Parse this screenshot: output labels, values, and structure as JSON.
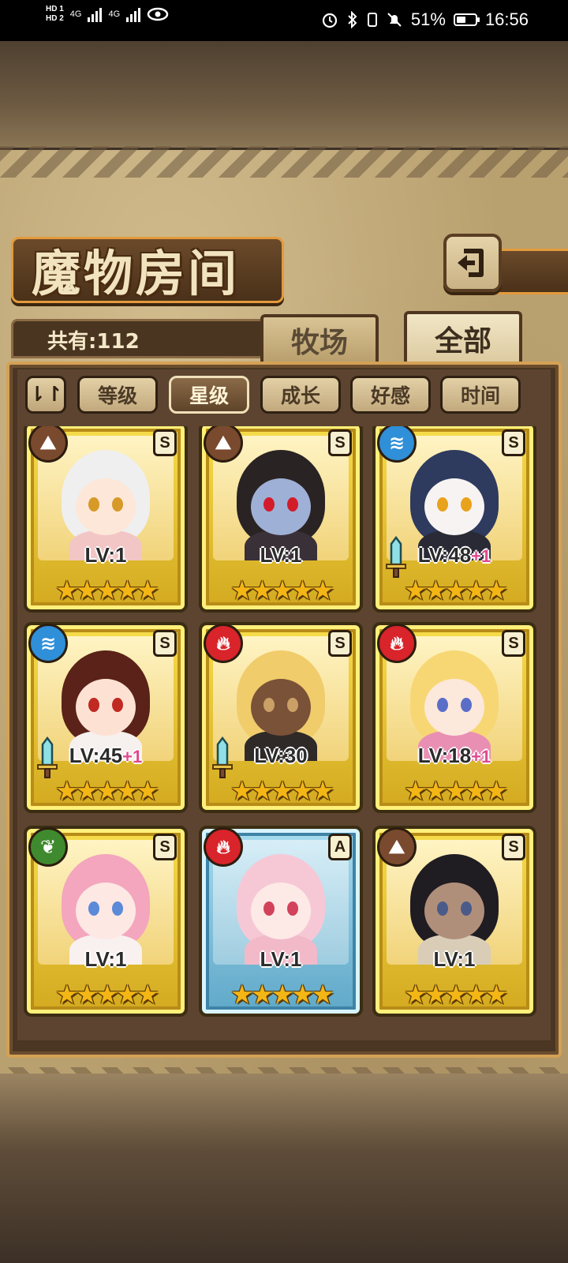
{
  "status_bar": {
    "hd1": "HD 1",
    "hd2": "HD 2",
    "net1": "4G",
    "net2": "4G",
    "battery_percent": "51%",
    "battery_level": 0.51,
    "time": "16:56"
  },
  "header": {
    "title": "魔物房间",
    "back_icon": "return-arrow-icon"
  },
  "summary": {
    "count_label": "共有:112"
  },
  "top_tabs": [
    {
      "label": "牧场",
      "active": false
    },
    {
      "label": "全部",
      "active": true
    }
  ],
  "sort_bar": {
    "toggle_label": "⇂↾",
    "buttons": [
      {
        "label": "等级",
        "active": false
      },
      {
        "label": "星级",
        "active": true
      },
      {
        "label": "成长",
        "active": false
      },
      {
        "label": "好感",
        "active": false
      },
      {
        "label": "时间",
        "active": false
      }
    ]
  },
  "colors": {
    "earth": "#7a4a2e",
    "water": "#2f8fd8",
    "fire": "#d8242a",
    "wood": "#3f8a2e"
  },
  "cards": [
    {
      "element": "earth",
      "element_icon": "earth-mountain-icon",
      "rank": "S",
      "level": "LV:1",
      "plus": "",
      "stars": "★★★★★",
      "weapon": false,
      "frame": "gold",
      "hair": "#efefef",
      "skin": "#fde7d8",
      "eye": "#d79a28",
      "outfit": "#f3c6c6"
    },
    {
      "element": "earth",
      "element_icon": "earth-mountain-icon",
      "rank": "S",
      "level": "LV:1",
      "plus": "",
      "stars": "★★★★★",
      "weapon": false,
      "frame": "gold",
      "hair": "#2a2324",
      "skin": "#9fb0d6",
      "eye": "#d21c2a",
      "outfit": "#3a3038"
    },
    {
      "element": "water",
      "element_icon": "water-waves-icon",
      "rank": "S",
      "level": "LV:48",
      "plus": "+1",
      "stars": "★★★★★",
      "weapon": true,
      "frame": "gold",
      "hair": "#2e3a5e",
      "skin": "#f7f3f2",
      "eye": "#e9a21c",
      "outfit": "#2a2a36"
    },
    {
      "element": "water",
      "element_icon": "water-waves-icon",
      "rank": "S",
      "level": "LV:45",
      "plus": "+1",
      "stars": "★★★★★",
      "weapon": true,
      "frame": "gold",
      "hair": "#5a2218",
      "skin": "#fde2d3",
      "eye": "#c02a22",
      "outfit": "#f6f0ee"
    },
    {
      "element": "fire",
      "element_icon": "fire-flame-icon",
      "rank": "S",
      "level": "LV:30",
      "plus": "",
      "stars": "★★★★★",
      "weapon": true,
      "frame": "gold",
      "hair": "#f0cc6b",
      "skin": "#7a5238",
      "eye": "#caa066",
      "outfit": "#2f2a28"
    },
    {
      "element": "fire",
      "element_icon": "fire-flame-icon",
      "rank": "S",
      "level": "LV:18",
      "plus": "+1",
      "stars": "★★★★★",
      "weapon": false,
      "frame": "gold",
      "hair": "#f7d774",
      "skin": "#fde8dc",
      "eye": "#5a6ec8",
      "outfit": "#e98fb4"
    },
    {
      "element": "wood",
      "element_icon": "wood-leaf-icon",
      "rank": "S",
      "level": "LV:1",
      "plus": "",
      "stars": "★★★★★",
      "weapon": false,
      "frame": "gold",
      "hair": "#f3a6bd",
      "skin": "#fde8e4",
      "eye": "#5a8ad8",
      "outfit": "#f8f1f0"
    },
    {
      "element": "fire",
      "element_icon": "fire-flame-icon",
      "rank": "A",
      "level": "LV:1",
      "plus": "",
      "stars": "★★★★★",
      "weapon": false,
      "frame": "blue",
      "hair": "#f6c8d6",
      "skin": "#fdeae6",
      "eye": "#d2425a",
      "outfit": "#f2b9c9"
    },
    {
      "element": "earth",
      "element_icon": "earth-mountain-icon",
      "rank": "S",
      "level": "LV:1",
      "plus": "",
      "stars": "★★★★★",
      "weapon": false,
      "frame": "gold",
      "hair": "#1f1c22",
      "skin": "#b08f7a",
      "eye": "#4a5b8a",
      "outfit": "#d9cdb8"
    }
  ]
}
